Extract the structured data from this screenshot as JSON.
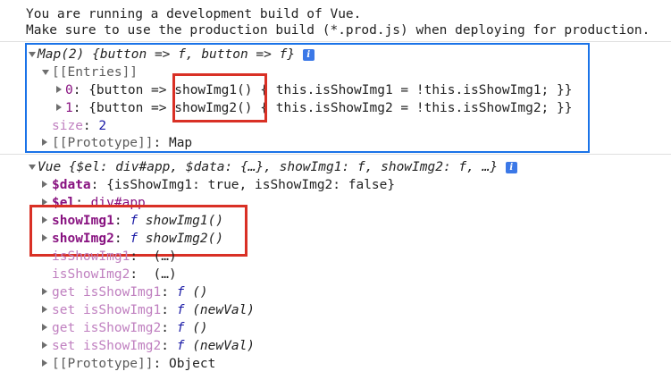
{
  "warning": {
    "line1": "You are running a development build of Vue.",
    "line2": "Make sure to use the production build (*.prod.js) when deploying for production."
  },
  "map_log": {
    "summary": "Map(2) {button => f, button => f}",
    "entries_label": "[[Entries]]",
    "entry0": {
      "index": "0",
      "key": "{button => ",
      "fn": "showImg1()",
      "body": " { this.isShowImg1 = !this.isShowImg1; }}"
    },
    "entry1": {
      "index": "1",
      "key": "{button => ",
      "fn": "showImg2()",
      "body": " { this.isShowImg2 = !this.isShowImg2; }}"
    },
    "size_key": "size",
    "size_val": "2",
    "prototype_key": "[[Prototype]]",
    "prototype_val": "Map"
  },
  "vue_log": {
    "summary": "Vue {$el: div#app, $data: {…}, showImg1: f, showImg2: f, …}",
    "data_key": "$data",
    "data_val": "{isShowImg1: true, isShowImg2: false}",
    "el_key": "$el",
    "el_val": "div#app",
    "showImg1_key": "showImg1",
    "showImg1_val": "showImg1()",
    "showImg2_key": "showImg2",
    "showImg2_val": "showImg2()",
    "isShowImg1_key": "isShowImg1",
    "isShowImg2_key": "isShowImg2",
    "lazy_val": "(…)",
    "get1": {
      "kw": "get",
      "name": "isShowImg1",
      "args": "()"
    },
    "set1": {
      "kw": "set",
      "name": "isShowImg1",
      "args": "(newVal)"
    },
    "get2": {
      "kw": "get",
      "name": "isShowImg2",
      "args": "()"
    },
    "set2": {
      "kw": "set",
      "name": "isShowImg2",
      "args": "(newVal)"
    },
    "prototype_key": "[[Prototype]]",
    "prototype_val": "Object"
  },
  "symbols": {
    "f": "f",
    "info": "i",
    "colon": ": "
  },
  "colors": {
    "highlight_blue": "#1a73e8",
    "highlight_red": "#d93025"
  }
}
